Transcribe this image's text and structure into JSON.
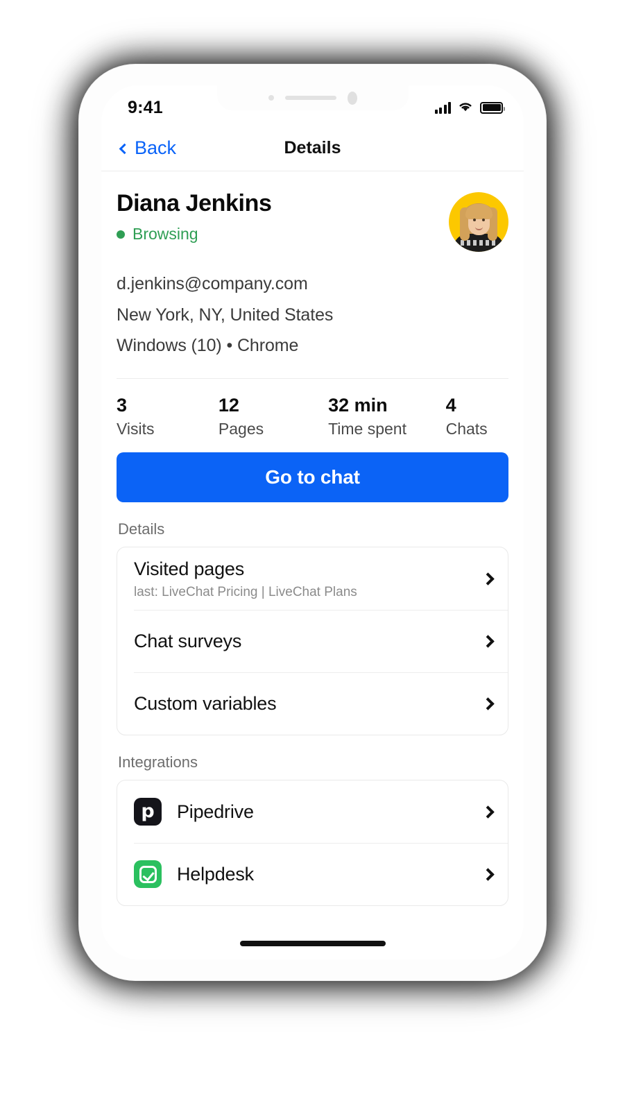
{
  "status_bar": {
    "time": "9:41",
    "signal_icon": "cellular-signal-icon",
    "wifi_icon": "wifi-icon",
    "battery_icon": "battery-icon"
  },
  "nav": {
    "back_label": "Back",
    "title": "Details",
    "back_icon": "chevron-left-icon"
  },
  "profile": {
    "name": "Diana Jenkins",
    "status": "Browsing",
    "status_color": "#2f9e54",
    "avatar_background": "#fcc800",
    "email": "d.jenkins@company.com",
    "location": "New York, NY, United States",
    "system": "Windows (10) • Chrome"
  },
  "stats": [
    {
      "value": "3",
      "label": "Visits"
    },
    {
      "value": "12",
      "label": "Pages"
    },
    {
      "value": "32 min",
      "label": "Time spent"
    },
    {
      "value": "4",
      "label": "Chats"
    }
  ],
  "cta": {
    "label": "Go to chat",
    "color": "#0b63f6"
  },
  "details": {
    "section_title": "Details",
    "rows": [
      {
        "title": "Visited pages",
        "subtitle": "last: LiveChat Pricing | LiveChat Plans",
        "chevron_icon": "chevron-right-icon"
      },
      {
        "title": "Chat surveys",
        "subtitle": "",
        "chevron_icon": "chevron-right-icon"
      },
      {
        "title": "Custom variables",
        "subtitle": "",
        "chevron_icon": "chevron-right-icon"
      }
    ]
  },
  "integrations": {
    "section_title": "Integrations",
    "rows": [
      {
        "title": "Pipedrive",
        "icon": "pipedrive-logo-icon",
        "icon_glyph": "p",
        "icon_color": "#14141a",
        "chevron_icon": "chevron-right-icon"
      },
      {
        "title": "Helpdesk",
        "icon": "helpdesk-logo-icon",
        "icon_glyph": "check",
        "icon_color": "#2bc05f",
        "chevron_icon": "chevron-right-icon"
      }
    ]
  },
  "home_indicator": "home-indicator-bar"
}
